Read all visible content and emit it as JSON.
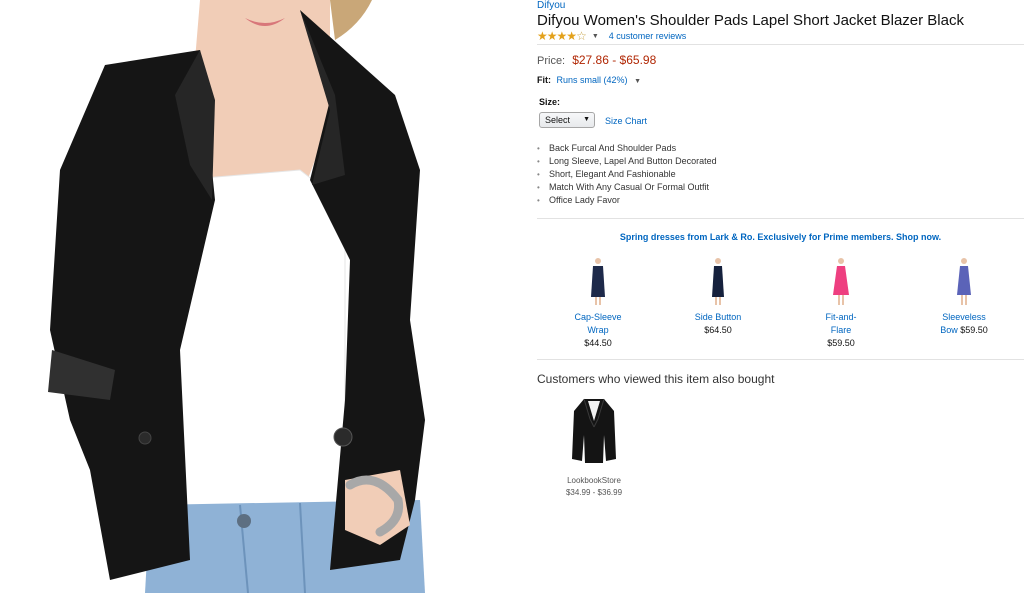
{
  "product": {
    "brand": "Difyou",
    "title": "Difyou Women's Shoulder Pads Lapel Short Jacket Blazer Black",
    "rating_stars": 3.5,
    "reviews_link": "4 customer reviews",
    "price_label": "Price:",
    "price": "$27.86 - $65.98",
    "fit_label": "Fit:",
    "fit_value": "Runs small (42%)",
    "size_label": "Size:",
    "size_select": "Select",
    "size_chart_link": "Size Chart",
    "bullets": [
      "Back Furcal And Shoulder Pads",
      "Long Sleeve, Lapel And Button Decorated",
      "Short, Elegant And Fashionable",
      "Match With Any Casual Or Formal Outfit",
      "Office Lady Favor"
    ]
  },
  "promo": {
    "headline": "Spring dresses from Lark & Ro. Exclusively for Prime members. Shop now.",
    "items": [
      {
        "name_line1": "Cap-Sleeve",
        "name_line2": "Wrap",
        "price": "$44.50",
        "color": "#1e2a4a"
      },
      {
        "name_line1": "Side Button",
        "name_line2": "",
        "price": "$64.50",
        "color": "#16213d"
      },
      {
        "name_line1": "Fit-and-",
        "name_line2": "Flare",
        "price": "$59.50",
        "color": "#ee3f80"
      },
      {
        "name_line1": "Sleeveless",
        "name_line2": "Bow",
        "price": "$59.50",
        "color": "#5b63b8"
      }
    ]
  },
  "also_bought": {
    "heading": "Customers who viewed this item also bought",
    "items": [
      {
        "store": "LookbookStore",
        "price_range": "$34.99 - $36.99"
      }
    ]
  },
  "colors": {
    "link": "#0066c0",
    "price": "#b12704",
    "star": "#e3a11b"
  }
}
